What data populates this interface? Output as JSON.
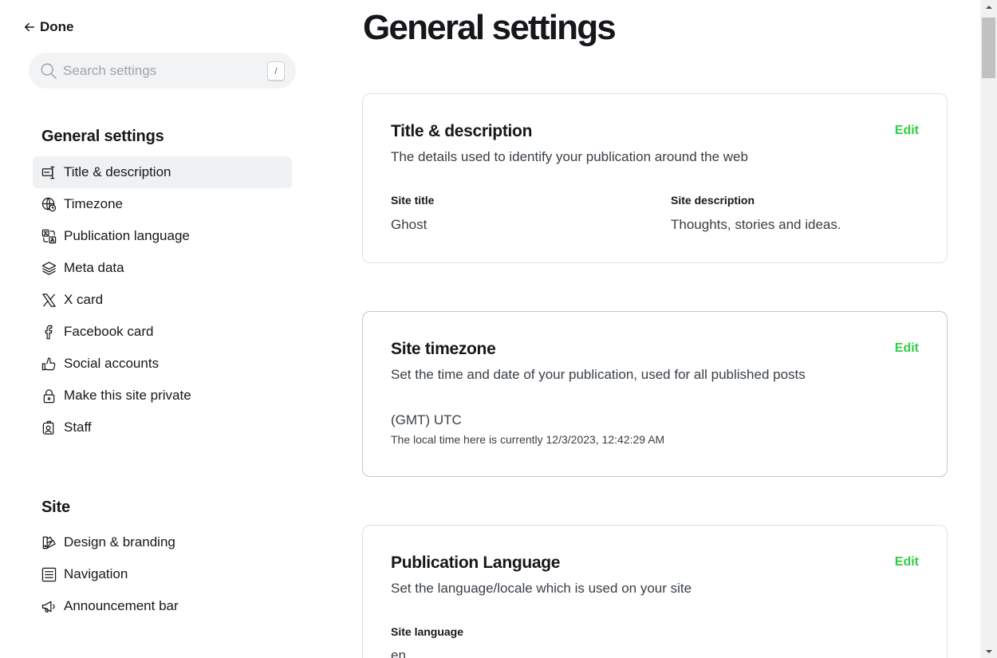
{
  "nav": {
    "done_label": "Done",
    "search_placeholder": "Search settings",
    "search_shortcut": "/"
  },
  "sidebar": {
    "general_title": "General settings",
    "general_items": [
      {
        "label": "Title & description",
        "icon": "title-description-icon",
        "active": true
      },
      {
        "label": "Timezone",
        "icon": "globe-clock-icon"
      },
      {
        "label": "Publication language",
        "icon": "translate-icon"
      },
      {
        "label": "Meta data",
        "icon": "layers-icon"
      },
      {
        "label": "X card",
        "icon": "x-logo-icon"
      },
      {
        "label": "Facebook card",
        "icon": "facebook-icon"
      },
      {
        "label": "Social accounts",
        "icon": "thumbs-up-icon"
      },
      {
        "label": "Make this site private",
        "icon": "lock-icon"
      },
      {
        "label": "Staff",
        "icon": "staff-icon"
      }
    ],
    "site_title": "Site",
    "site_items": [
      {
        "label": "Design & branding",
        "icon": "paint-icon"
      },
      {
        "label": "Navigation",
        "icon": "list-icon"
      },
      {
        "label": "Announcement bar",
        "icon": "megaphone-icon"
      }
    ]
  },
  "main": {
    "title": "General settings",
    "cards": {
      "title_description": {
        "heading": "Title & description",
        "description": "The details used to identify your publication around the web",
        "edit_label": "Edit",
        "site_title_label": "Site title",
        "site_title_value": "Ghost",
        "site_description_label": "Site description",
        "site_description_value": "Thoughts, stories and ideas."
      },
      "timezone": {
        "heading": "Site timezone",
        "description": "Set the time and date of your publication, used for all published posts",
        "edit_label": "Edit",
        "value": "(GMT) UTC",
        "hint": "The local time here is currently 12/3/2023, 12:42:29 AM"
      },
      "language": {
        "heading": "Publication Language",
        "description": "Set the language/locale which is used on your site",
        "edit_label": "Edit",
        "site_language_label": "Site language",
        "site_language_value": "en"
      }
    }
  },
  "colors": {
    "accent": "#30cf43",
    "text": "#15171a",
    "active_bg": "#eff1f3",
    "search_bg": "#f1f3f4"
  }
}
